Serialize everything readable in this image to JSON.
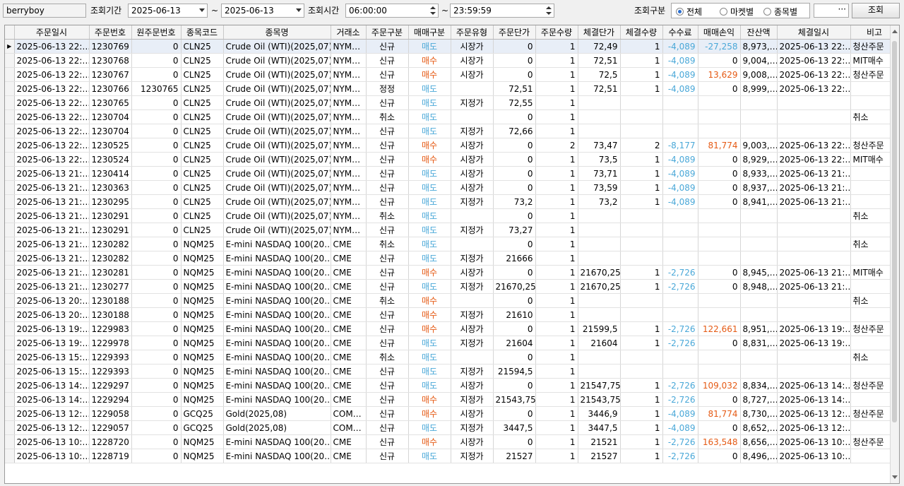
{
  "toolbar": {
    "user": "berryboy",
    "period_label": "조회기간",
    "date_from": "2025-06-13",
    "tilde1": "~",
    "date_to": "2025-06-13",
    "time_label": "조회시간",
    "time_from": "06:00:00",
    "tilde2": "~",
    "time_to": "23:59:59",
    "type_label": "조회구분",
    "radio_all": "전체",
    "radio_market": "마켓별",
    "radio_symbol": "종목별",
    "extra_field": "",
    "ellipsis": "···",
    "search_button": "조회",
    "selected_radio": "전체"
  },
  "colors": {
    "sell": "#4aa8d8",
    "buy": "#e55a14",
    "negative": "#4aa8d8",
    "positive": "#e55a14"
  },
  "columns": [
    "주문일시",
    "주문번호",
    "원주문번호",
    "종목코드",
    "종목명",
    "거래소",
    "주문구분",
    "매매구분",
    "주문유형",
    "주문단가",
    "주문수량",
    "체결단가",
    "체결수량",
    "수수료",
    "매매손익",
    "잔산액",
    "체결일시",
    "비고"
  ],
  "rows": [
    {
      "dt": "2025-06-13 22:…",
      "no": "1230769",
      "orig": "0",
      "code": "CLN25",
      "name": "Crude Oil (WTI)(2025,07)",
      "ex": "NYM…",
      "kind": "신규",
      "side": "매도",
      "type": "시장가",
      "price": "0",
      "qty": "1",
      "fprice": "72,49",
      "fqty": "1",
      "fee": "-4,089",
      "pnl": "-27,258",
      "bal": "8,973,…",
      "fdt": "2025-06-13 22:…",
      "note": "청산주문"
    },
    {
      "dt": "2025-06-13 22:…",
      "no": "1230768",
      "orig": "0",
      "code": "CLN25",
      "name": "Crude Oil (WTI)(2025,07)",
      "ex": "NYM…",
      "kind": "신규",
      "side": "매수",
      "type": "시장가",
      "price": "0",
      "qty": "1",
      "fprice": "72,51",
      "fqty": "1",
      "fee": "-4,089",
      "pnl": "0",
      "bal": "9,004,…",
      "fdt": "2025-06-13 22:…",
      "note": "MIT매수"
    },
    {
      "dt": "2025-06-13 22:…",
      "no": "1230767",
      "orig": "0",
      "code": "CLN25",
      "name": "Crude Oil (WTI)(2025,07)",
      "ex": "NYM…",
      "kind": "신규",
      "side": "매수",
      "type": "시장가",
      "price": "0",
      "qty": "1",
      "fprice": "72,5",
      "fqty": "1",
      "fee": "-4,089",
      "pnl": "13,629",
      "bal": "9,008,…",
      "fdt": "2025-06-13 22:…",
      "note": "청산주문"
    },
    {
      "dt": "2025-06-13 22:…",
      "no": "1230766",
      "orig": "1230765",
      "code": "CLN25",
      "name": "Crude Oil (WTI)(2025,07)",
      "ex": "NYM…",
      "kind": "정정",
      "side": "매도",
      "type": "",
      "price": "72,51",
      "qty": "1",
      "fprice": "72,51",
      "fqty": "1",
      "fee": "-4,089",
      "pnl": "0",
      "bal": "8,999,…",
      "fdt": "2025-06-13 22:…",
      "note": ""
    },
    {
      "dt": "2025-06-13 22:…",
      "no": "1230765",
      "orig": "0",
      "code": "CLN25",
      "name": "Crude Oil (WTI)(2025,07)",
      "ex": "NYM…",
      "kind": "신규",
      "side": "매도",
      "type": "지정가",
      "price": "72,55",
      "qty": "1",
      "fprice": "",
      "fqty": "",
      "fee": "",
      "pnl": "",
      "bal": "",
      "fdt": "",
      "note": ""
    },
    {
      "dt": "2025-06-13 22:…",
      "no": "1230704",
      "orig": "0",
      "code": "CLN25",
      "name": "Crude Oil (WTI)(2025,07)",
      "ex": "NYM…",
      "kind": "취소",
      "side": "매도",
      "type": "",
      "price": "0",
      "qty": "1",
      "fprice": "",
      "fqty": "",
      "fee": "",
      "pnl": "",
      "bal": "",
      "fdt": "",
      "note": "취소"
    },
    {
      "dt": "2025-06-13 22:…",
      "no": "1230704",
      "orig": "0",
      "code": "CLN25",
      "name": "Crude Oil (WTI)(2025,07)",
      "ex": "NYM…",
      "kind": "신규",
      "side": "매도",
      "type": "지정가",
      "price": "72,66",
      "qty": "1",
      "fprice": "",
      "fqty": "",
      "fee": "",
      "pnl": "",
      "bal": "",
      "fdt": "",
      "note": ""
    },
    {
      "dt": "2025-06-13 22:…",
      "no": "1230525",
      "orig": "0",
      "code": "CLN25",
      "name": "Crude Oil (WTI)(2025,07)",
      "ex": "NYM…",
      "kind": "신규",
      "side": "매수",
      "type": "시장가",
      "price": "0",
      "qty": "2",
      "fprice": "73,47",
      "fqty": "2",
      "fee": "-8,177",
      "pnl": "81,774",
      "bal": "9,003,…",
      "fdt": "2025-06-13 22:…",
      "note": "청산주문"
    },
    {
      "dt": "2025-06-13 22:…",
      "no": "1230524",
      "orig": "0",
      "code": "CLN25",
      "name": "Crude Oil (WTI)(2025,07)",
      "ex": "NYM…",
      "kind": "신규",
      "side": "매수",
      "type": "시장가",
      "price": "0",
      "qty": "1",
      "fprice": "73,5",
      "fqty": "1",
      "fee": "-4,089",
      "pnl": "0",
      "bal": "8,929,…",
      "fdt": "2025-06-13 22:…",
      "note": "MIT매수"
    },
    {
      "dt": "2025-06-13 21:…",
      "no": "1230414",
      "orig": "0",
      "code": "CLN25",
      "name": "Crude Oil (WTI)(2025,07)",
      "ex": "NYM…",
      "kind": "신규",
      "side": "매도",
      "type": "시장가",
      "price": "0",
      "qty": "1",
      "fprice": "73,71",
      "fqty": "1",
      "fee": "-4,089",
      "pnl": "0",
      "bal": "8,933,…",
      "fdt": "2025-06-13 21:…",
      "note": ""
    },
    {
      "dt": "2025-06-13 21:…",
      "no": "1230363",
      "orig": "0",
      "code": "CLN25",
      "name": "Crude Oil (WTI)(2025,07)",
      "ex": "NYM…",
      "kind": "신규",
      "side": "매도",
      "type": "시장가",
      "price": "0",
      "qty": "1",
      "fprice": "73,59",
      "fqty": "1",
      "fee": "-4,089",
      "pnl": "0",
      "bal": "8,937,…",
      "fdt": "2025-06-13 21:…",
      "note": ""
    },
    {
      "dt": "2025-06-13 21:…",
      "no": "1230295",
      "orig": "0",
      "code": "CLN25",
      "name": "Crude Oil (WTI)(2025,07)",
      "ex": "NYM…",
      "kind": "신규",
      "side": "매도",
      "type": "지정가",
      "price": "73,2",
      "qty": "1",
      "fprice": "73,2",
      "fqty": "1",
      "fee": "-4,089",
      "pnl": "0",
      "bal": "8,941,…",
      "fdt": "2025-06-13 21:…",
      "note": ""
    },
    {
      "dt": "2025-06-13 21:…",
      "no": "1230291",
      "orig": "0",
      "code": "CLN25",
      "name": "Crude Oil (WTI)(2025,07)",
      "ex": "NYM…",
      "kind": "취소",
      "side": "매도",
      "type": "",
      "price": "0",
      "qty": "1",
      "fprice": "",
      "fqty": "",
      "fee": "",
      "pnl": "",
      "bal": "",
      "fdt": "",
      "note": "취소"
    },
    {
      "dt": "2025-06-13 21:…",
      "no": "1230291",
      "orig": "0",
      "code": "CLN25",
      "name": "Crude Oil (WTI)(2025,07)",
      "ex": "NYM…",
      "kind": "신규",
      "side": "매도",
      "type": "지정가",
      "price": "73,27",
      "qty": "1",
      "fprice": "",
      "fqty": "",
      "fee": "",
      "pnl": "",
      "bal": "",
      "fdt": "",
      "note": ""
    },
    {
      "dt": "2025-06-13 21:…",
      "no": "1230282",
      "orig": "0",
      "code": "NQM25",
      "name": "E-mini NASDAQ 100(20…",
      "ex": "CME",
      "kind": "취소",
      "side": "매도",
      "type": "",
      "price": "0",
      "qty": "1",
      "fprice": "",
      "fqty": "",
      "fee": "",
      "pnl": "",
      "bal": "",
      "fdt": "",
      "note": "취소"
    },
    {
      "dt": "2025-06-13 21:…",
      "no": "1230282",
      "orig": "0",
      "code": "NQM25",
      "name": "E-mini NASDAQ 100(20…",
      "ex": "CME",
      "kind": "신규",
      "side": "매도",
      "type": "지정가",
      "price": "21666",
      "qty": "1",
      "fprice": "",
      "fqty": "",
      "fee": "",
      "pnl": "",
      "bal": "",
      "fdt": "",
      "note": ""
    },
    {
      "dt": "2025-06-13 21:…",
      "no": "1230281",
      "orig": "0",
      "code": "NQM25",
      "name": "E-mini NASDAQ 100(20…",
      "ex": "CME",
      "kind": "신규",
      "side": "매수",
      "type": "시장가",
      "price": "0",
      "qty": "1",
      "fprice": "21670,25",
      "fqty": "1",
      "fee": "-2,726",
      "pnl": "0",
      "bal": "8,945,…",
      "fdt": "2025-06-13 21:…",
      "note": "MIT매수"
    },
    {
      "dt": "2025-06-13 21:…",
      "no": "1230277",
      "orig": "0",
      "code": "NQM25",
      "name": "E-mini NASDAQ 100(20…",
      "ex": "CME",
      "kind": "신규",
      "side": "매도",
      "type": "지정가",
      "price": "21670,25",
      "qty": "1",
      "fprice": "21670,25",
      "fqty": "1",
      "fee": "-2,726",
      "pnl": "0",
      "bal": "8,948,…",
      "fdt": "2025-06-13 21:…",
      "note": ""
    },
    {
      "dt": "2025-06-13 20:…",
      "no": "1230188",
      "orig": "0",
      "code": "NQM25",
      "name": "E-mini NASDAQ 100(20…",
      "ex": "CME",
      "kind": "취소",
      "side": "매수",
      "type": "",
      "price": "0",
      "qty": "1",
      "fprice": "",
      "fqty": "",
      "fee": "",
      "pnl": "",
      "bal": "",
      "fdt": "",
      "note": "취소"
    },
    {
      "dt": "2025-06-13 20:…",
      "no": "1230188",
      "orig": "0",
      "code": "NQM25",
      "name": "E-mini NASDAQ 100(20…",
      "ex": "CME",
      "kind": "신규",
      "side": "매수",
      "type": "지정가",
      "price": "21610",
      "qty": "1",
      "fprice": "",
      "fqty": "",
      "fee": "",
      "pnl": "",
      "bal": "",
      "fdt": "",
      "note": ""
    },
    {
      "dt": "2025-06-13 19:…",
      "no": "1229983",
      "orig": "0",
      "code": "NQM25",
      "name": "E-mini NASDAQ 100(20…",
      "ex": "CME",
      "kind": "신규",
      "side": "매수",
      "type": "시장가",
      "price": "0",
      "qty": "1",
      "fprice": "21599,5",
      "fqty": "1",
      "fee": "-2,726",
      "pnl": "122,661",
      "bal": "8,951,…",
      "fdt": "2025-06-13 19:…",
      "note": "청산주문"
    },
    {
      "dt": "2025-06-13 19:…",
      "no": "1229978",
      "orig": "0",
      "code": "NQM25",
      "name": "E-mini NASDAQ 100(20…",
      "ex": "CME",
      "kind": "신규",
      "side": "매도",
      "type": "지정가",
      "price": "21604",
      "qty": "1",
      "fprice": "21604",
      "fqty": "1",
      "fee": "-2,726",
      "pnl": "0",
      "bal": "8,831,…",
      "fdt": "2025-06-13 19:…",
      "note": ""
    },
    {
      "dt": "2025-06-13 15:…",
      "no": "1229393",
      "orig": "0",
      "code": "NQM25",
      "name": "E-mini NASDAQ 100(20…",
      "ex": "CME",
      "kind": "취소",
      "side": "매도",
      "type": "",
      "price": "0",
      "qty": "1",
      "fprice": "",
      "fqty": "",
      "fee": "",
      "pnl": "",
      "bal": "",
      "fdt": "",
      "note": "취소"
    },
    {
      "dt": "2025-06-13 15:…",
      "no": "1229393",
      "orig": "0",
      "code": "NQM25",
      "name": "E-mini NASDAQ 100(20…",
      "ex": "CME",
      "kind": "신규",
      "side": "매도",
      "type": "지정가",
      "price": "21594,5",
      "qty": "1",
      "fprice": "",
      "fqty": "",
      "fee": "",
      "pnl": "",
      "bal": "",
      "fdt": "",
      "note": ""
    },
    {
      "dt": "2025-06-13 14:…",
      "no": "1229297",
      "orig": "0",
      "code": "NQM25",
      "name": "E-mini NASDAQ 100(20…",
      "ex": "CME",
      "kind": "신규",
      "side": "매도",
      "type": "시장가",
      "price": "0",
      "qty": "1",
      "fprice": "21547,75",
      "fqty": "1",
      "fee": "-2,726",
      "pnl": "109,032",
      "bal": "8,834,…",
      "fdt": "2025-06-13 14:…",
      "note": "청산주문"
    },
    {
      "dt": "2025-06-13 14:…",
      "no": "1229294",
      "orig": "0",
      "code": "NQM25",
      "name": "E-mini NASDAQ 100(20…",
      "ex": "CME",
      "kind": "신규",
      "side": "매수",
      "type": "지정가",
      "price": "21543,75",
      "qty": "1",
      "fprice": "21543,75",
      "fqty": "1",
      "fee": "-2,726",
      "pnl": "0",
      "bal": "8,727,…",
      "fdt": "2025-06-13 14:…",
      "note": ""
    },
    {
      "dt": "2025-06-13 12:…",
      "no": "1229058",
      "orig": "0",
      "code": "GCQ25",
      "name": "Gold(2025,08)",
      "ex": "COM…",
      "kind": "신규",
      "side": "매수",
      "type": "시장가",
      "price": "0",
      "qty": "1",
      "fprice": "3446,9",
      "fqty": "1",
      "fee": "-4,089",
      "pnl": "81,774",
      "bal": "8,730,…",
      "fdt": "2025-06-13 12:…",
      "note": "청산주문"
    },
    {
      "dt": "2025-06-13 12:…",
      "no": "1229057",
      "orig": "0",
      "code": "GCQ25",
      "name": "Gold(2025,08)",
      "ex": "COM…",
      "kind": "신규",
      "side": "매도",
      "type": "지정가",
      "price": "3447,5",
      "qty": "1",
      "fprice": "3447,5",
      "fqty": "1",
      "fee": "-4,089",
      "pnl": "0",
      "bal": "8,652,…",
      "fdt": "2025-06-13 12:…",
      "note": ""
    },
    {
      "dt": "2025-06-13 10:…",
      "no": "1228720",
      "orig": "0",
      "code": "NQM25",
      "name": "E-mini NASDAQ 100(20…",
      "ex": "CME",
      "kind": "신규",
      "side": "매수",
      "type": "시장가",
      "price": "0",
      "qty": "1",
      "fprice": "21521",
      "fqty": "1",
      "fee": "-2,726",
      "pnl": "163,548",
      "bal": "8,656,…",
      "fdt": "2025-06-13 10:…",
      "note": "청산주문"
    },
    {
      "dt": "2025-06-13 10:…",
      "no": "1228719",
      "orig": "0",
      "code": "NQM25",
      "name": "E-mini NASDAQ 100(20…",
      "ex": "CME",
      "kind": "신규",
      "side": "매도",
      "type": "지정가",
      "price": "21527",
      "qty": "1",
      "fprice": "21527",
      "fqty": "1",
      "fee": "-2,726",
      "pnl": "0",
      "bal": "8,496,…",
      "fdt": "2025-06-13 10:…",
      "note": ""
    }
  ]
}
